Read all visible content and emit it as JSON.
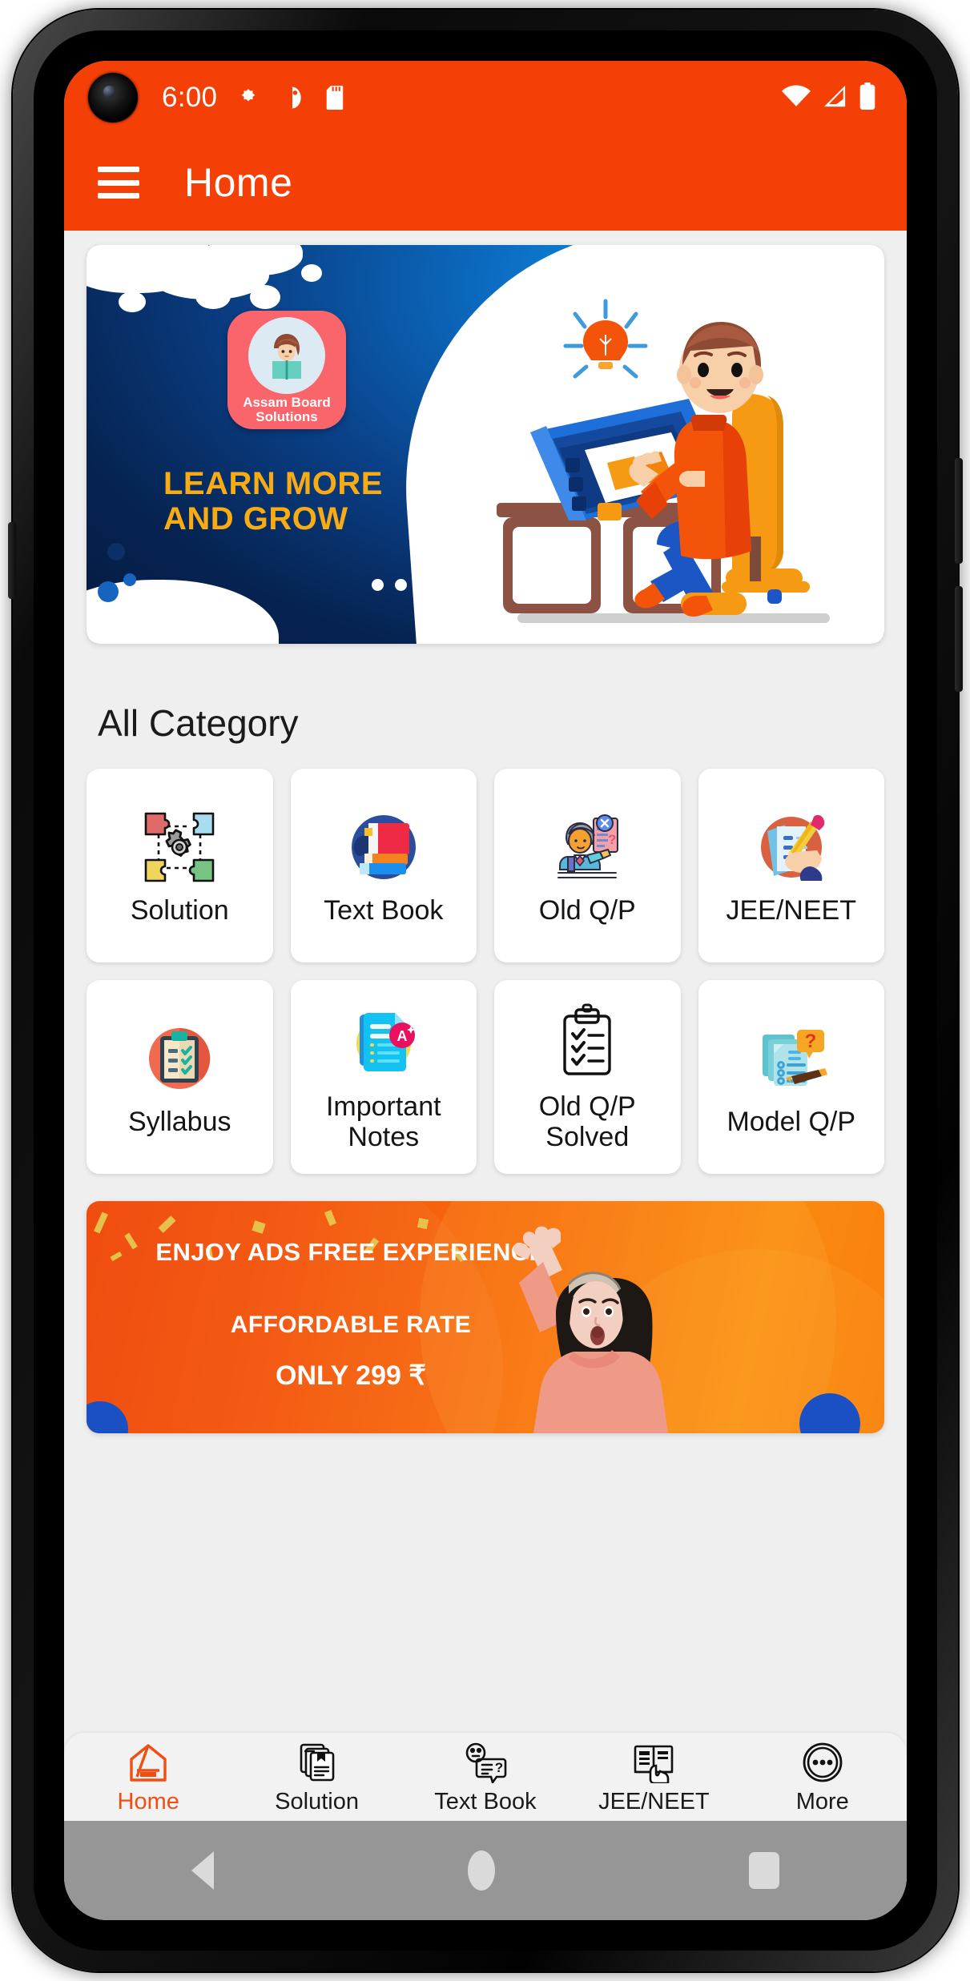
{
  "status_bar": {
    "time": "6:00",
    "icons": [
      "puzzle-notification-icon",
      "contrast-circle-icon",
      "sd-card-icon"
    ],
    "right_icons": [
      "wifi-icon",
      "cellular-signal-icon",
      "battery-icon"
    ]
  },
  "app_bar": {
    "menu_icon": "hamburger-menu-icon",
    "title": "Home"
  },
  "hero_banner": {
    "logo_title_line1": "Assam Board",
    "logo_title_line2": "Solutions",
    "headline_line1": "LEARN MORE",
    "headline_line2": "AND GROW",
    "logo_icon": "girl-reading-book-icon",
    "illustration": "student-at-desk-illustration",
    "pager_dots": 3,
    "pager_active_index": 1,
    "colors": {
      "deep_navy": "#041b40",
      "bright_blue": "#119ae8",
      "headline_yellow": "#f9ab13",
      "logo_pink": "#f9656a"
    }
  },
  "categories_section": {
    "title": "All Category",
    "items": [
      {
        "label": "Solution",
        "icon": "puzzle-gear-icon"
      },
      {
        "label": "Text Book",
        "icon": "stacked-books-icon"
      },
      {
        "label": "Old Q/P",
        "icon": "teacher-question-paper-icon"
      },
      {
        "label": "JEE/NEET",
        "icon": "hand-writing-exam-icon"
      },
      {
        "label": "Syllabus",
        "icon": "clipboard-checklist-icon"
      },
      {
        "label": "Important Notes",
        "icon": "notes-a-plus-icon"
      },
      {
        "label": "Old Q/P Solved",
        "icon": "clipboard-outline-checks-icon"
      },
      {
        "label": "Model Q/P",
        "icon": "documents-question-mark-icon"
      }
    ]
  },
  "promo_banner": {
    "line1": "ENJOY ADS FREE EXPERIENCE",
    "line2": "AFFORDABLE RATE",
    "line3": "ONLY 299 ₹",
    "image": "excited-woman-photo",
    "colors": {
      "orange_start": "#ef4606",
      "orange_end": "#fb8b10",
      "accent_blue": "#1b50c4"
    }
  },
  "bottom_nav": {
    "active_color": "#f04e13",
    "items": [
      {
        "label": "Home",
        "icon": "home-outline-icon",
        "active": true
      },
      {
        "label": "Solution",
        "icon": "documents-stack-icon",
        "active": false
      },
      {
        "label": "Text Book",
        "icon": "face-speech-bubble-icon",
        "active": false
      },
      {
        "label": "JEE/NEET",
        "icon": "open-book-hand-icon",
        "active": false
      },
      {
        "label": "More",
        "icon": "more-dots-circle-icon",
        "active": false
      }
    ]
  },
  "android_nav": {
    "back": "back-triangle-icon",
    "home": "home-pill-icon",
    "recents": "recents-square-icon"
  }
}
